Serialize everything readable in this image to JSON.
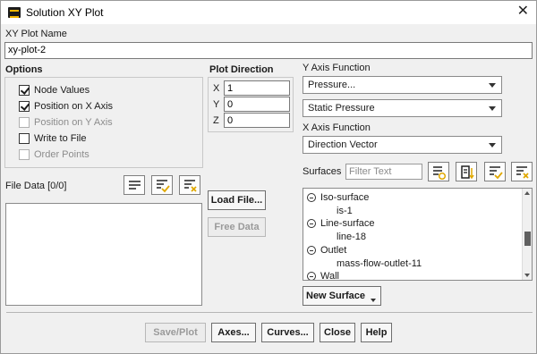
{
  "window": {
    "title": "Solution XY Plot",
    "close_glyph": "✕"
  },
  "plot_name": {
    "label": "XY Plot Name",
    "value": "xy-plot-2"
  },
  "options": {
    "heading": "Options",
    "items": [
      {
        "label": "Node Values",
        "checked": true,
        "enabled": true
      },
      {
        "label": "Position on X Axis",
        "checked": true,
        "enabled": true
      },
      {
        "label": "Position on Y Axis",
        "checked": false,
        "enabled": false
      },
      {
        "label": "Write to File",
        "checked": false,
        "enabled": true
      },
      {
        "label": "Order Points",
        "checked": false,
        "enabled": false
      }
    ]
  },
  "plot_direction": {
    "heading": "Plot Direction",
    "x_label": "X",
    "x_value": "1",
    "y_label": "Y",
    "y_value": "0",
    "z_label": "Z",
    "z_value": "0"
  },
  "y_axis_function": {
    "label": "Y Axis Function",
    "category": "Pressure...",
    "quantity": "Static Pressure"
  },
  "x_axis_function": {
    "label": "X Axis Function",
    "value": "Direction Vector"
  },
  "surfaces": {
    "label": "Surfaces",
    "filter_placeholder": "Filter Text",
    "items": [
      {
        "label": "Iso-surface",
        "type": "group"
      },
      {
        "label": "is-1",
        "type": "item"
      },
      {
        "label": "Line-surface",
        "type": "group"
      },
      {
        "label": "line-18",
        "type": "item"
      },
      {
        "label": "Outlet",
        "type": "group"
      },
      {
        "label": "mass-flow-outlet-11",
        "type": "item"
      },
      {
        "label": "Wall",
        "type": "group"
      }
    ],
    "new_surface_label": "New Surface"
  },
  "file_data": {
    "label": "File Data [0/0]"
  },
  "buttons": {
    "load_file": "Load File...",
    "free_data": "Free Data",
    "save_plot": "Save/Plot",
    "axes": "Axes...",
    "curves": "Curves...",
    "close": "Close",
    "help": "Help"
  },
  "icons": {
    "app": "fluent-app-icon",
    "list_all": "select-all-icon",
    "list_check": "check-list-icon",
    "list_clear": "clear-list-icon",
    "filter_group": "group-by-type-icon",
    "filter_sort": "sort-list-icon"
  },
  "colors": {
    "accent_yellow": "#f2b600",
    "background": "#f0f0f0"
  }
}
